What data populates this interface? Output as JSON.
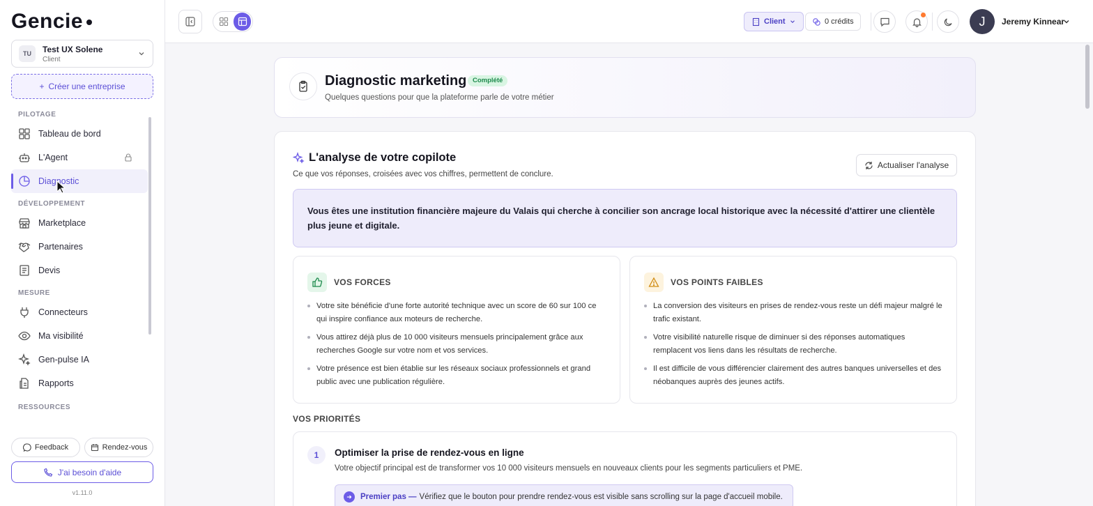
{
  "brand": {
    "name": "Gencie"
  },
  "company": {
    "initials": "TU",
    "name": "Test UX Solene",
    "role": "Client"
  },
  "create_company_label": "Créer une entreprise",
  "nav": {
    "pilotage": "PILOTAGE",
    "dashboard": "Tableau de bord",
    "agent": "L'Agent",
    "diagnostic": "Diagnostic",
    "developpement": "DÉVELOPPEMENT",
    "marketplace": "Marketplace",
    "partners": "Partenaires",
    "quotes": "Devis",
    "mesure": "MESURE",
    "connectors": "Connecteurs",
    "visibility": "Ma visibilité",
    "genpulse": "Gen-pulse IA",
    "reports": "Rapports",
    "ressources": "RESSOURCES"
  },
  "footer": {
    "feedback": "Feedback",
    "appointment": "Rendez-vous",
    "help": "J'ai besoin d'aide",
    "version": "v1.11.0"
  },
  "topbar": {
    "client_label": "Client",
    "credits_label": "0 crédits",
    "user_initial": "J",
    "user_name": "Jeremy Kinnear"
  },
  "header": {
    "title": "Diagnostic marketing",
    "badge": "Complété",
    "subtitle": "Quelques questions pour que la plateforme parle de votre métier"
  },
  "analysis": {
    "title": "L'analyse de votre copilote",
    "subtitle": "Ce que vos réponses, croisées avec vos chiffres, permettent de conclure.",
    "refresh_label": "Actualiser l'analyse",
    "summary": "Vous êtes une institution financière majeure du Valais qui cherche à concilier son ancrage local historique avec la nécessité d'attirer une clientèle plus jeune et digitale.",
    "strengths_title": "VOS FORCES",
    "strengths": [
      "Votre site bénéficie d'une forte autorité technique avec un score de 60 sur 100 ce qui inspire confiance aux moteurs de recherche.",
      "Vous attirez déjà plus de 10 000 visiteurs mensuels principalement grâce aux recherches Google sur votre nom et vos services.",
      "Votre présence est bien établie sur les réseaux sociaux professionnels et grand public avec une publication régulière."
    ],
    "weaknesses_title": "VOS POINTS FAIBLES",
    "weaknesses": [
      "La conversion des visiteurs en prises de rendez-vous reste un défi majeur malgré le trafic existant.",
      "Votre visibilité naturelle risque de diminuer si des réponses automatiques remplacent vos liens dans les résultats de recherche.",
      "Il est difficile de vous différencier clairement des autres banques universelles et des néobanques auprès des jeunes actifs."
    ],
    "priorities_title": "VOS PRIORITÉS",
    "priority": {
      "number": "1",
      "title": "Optimiser la prise de rendez-vous en ligne",
      "subtitle": "Votre objectif principal est de transformer vos 10 000 visiteurs mensuels en nouveaux clients pour les segments particuliers et PME.",
      "step_label": "Premier pas —",
      "step_text": "Vérifiez que le bouton pour prendre rendez-vous est visible sans scrolling sur la page d'accueil mobile."
    }
  },
  "colors": {
    "accent": "#6c5ce7",
    "success": "#1d8a4c",
    "warning": "#e8a020",
    "notif": "#ff7a2f"
  }
}
